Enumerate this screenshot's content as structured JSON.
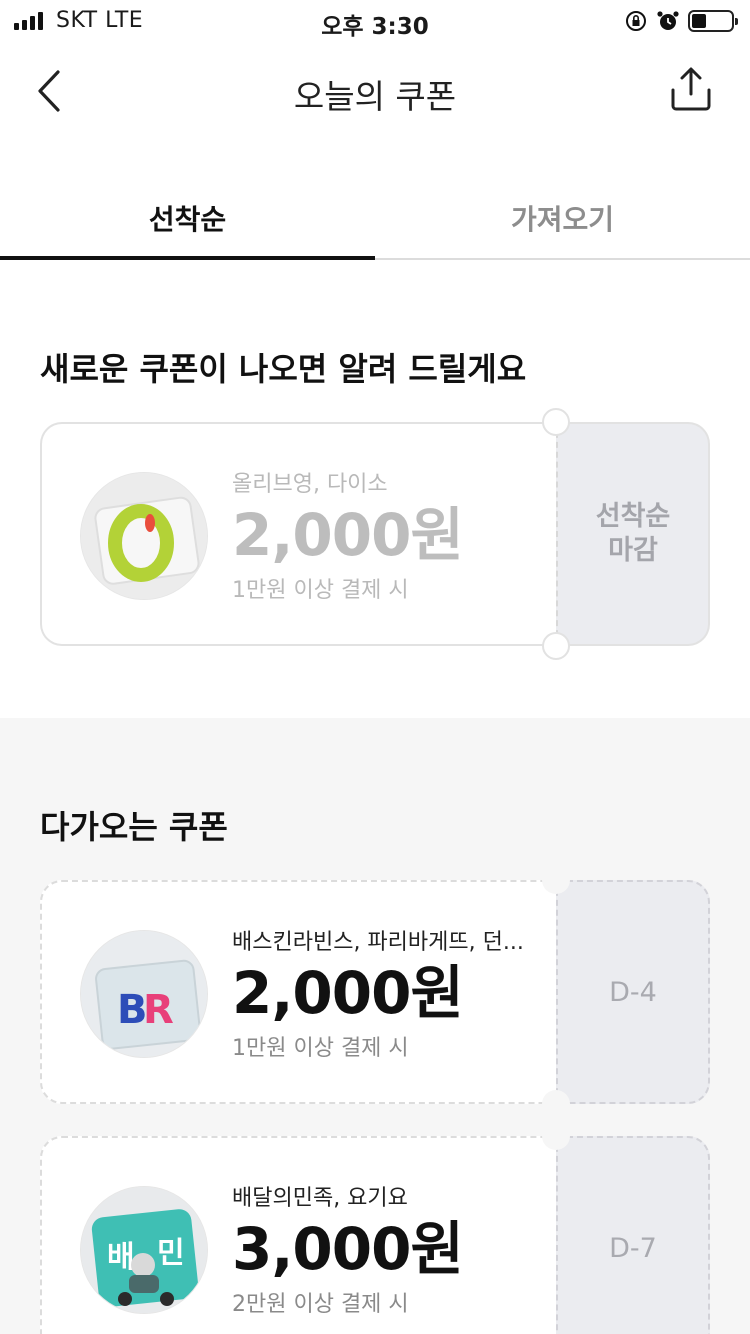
{
  "status_bar": {
    "carrier": "SKT   LTE",
    "time": "오후 3:30",
    "icons": [
      "signal-icon",
      "lock-rotation-icon",
      "alarm-icon",
      "battery-icon"
    ]
  },
  "nav": {
    "title": "오늘의 쿠폰",
    "back_icon": "chevron-left-icon",
    "share_icon": "share-icon"
  },
  "tabs": [
    {
      "label": "선착순",
      "active": true
    },
    {
      "label": "가져오기",
      "active": false
    }
  ],
  "new_section": {
    "title": "새로운 쿠폰이 나오면 알려 드릴게요",
    "coupon": {
      "brand": "올리브영, 다이소",
      "amount": "2,000원",
      "condition": "1만원 이상 결제 시",
      "status": "선착순\n마감",
      "logo": "oliveyoung-logo"
    }
  },
  "upcoming_section": {
    "title": "다가오는 쿠폰",
    "coupons": [
      {
        "brand": "배스킨라빈스, 파리바게뜨, 던...",
        "amount": "2,000원",
        "condition": "1만원 이상 결제 시",
        "dday": "D-4",
        "logo": "baskin-robbins-logo",
        "logo_text": "BR"
      },
      {
        "brand": "배달의민족, 요기요",
        "amount": "3,000원",
        "condition": "2만원 이상 결제 시",
        "dday": "D-7",
        "logo": "baemin-logo",
        "logo_text": "배민"
      }
    ]
  },
  "colors": {
    "active_tab_underline": "#111111",
    "side_panel": "#ebecf0",
    "section_bg": "#f6f6f6",
    "br_pink": "#e8407a",
    "br_blue": "#2d4db8",
    "baemin_teal": "#3fbfb4",
    "oliveyoung_green": "#b3d237"
  }
}
